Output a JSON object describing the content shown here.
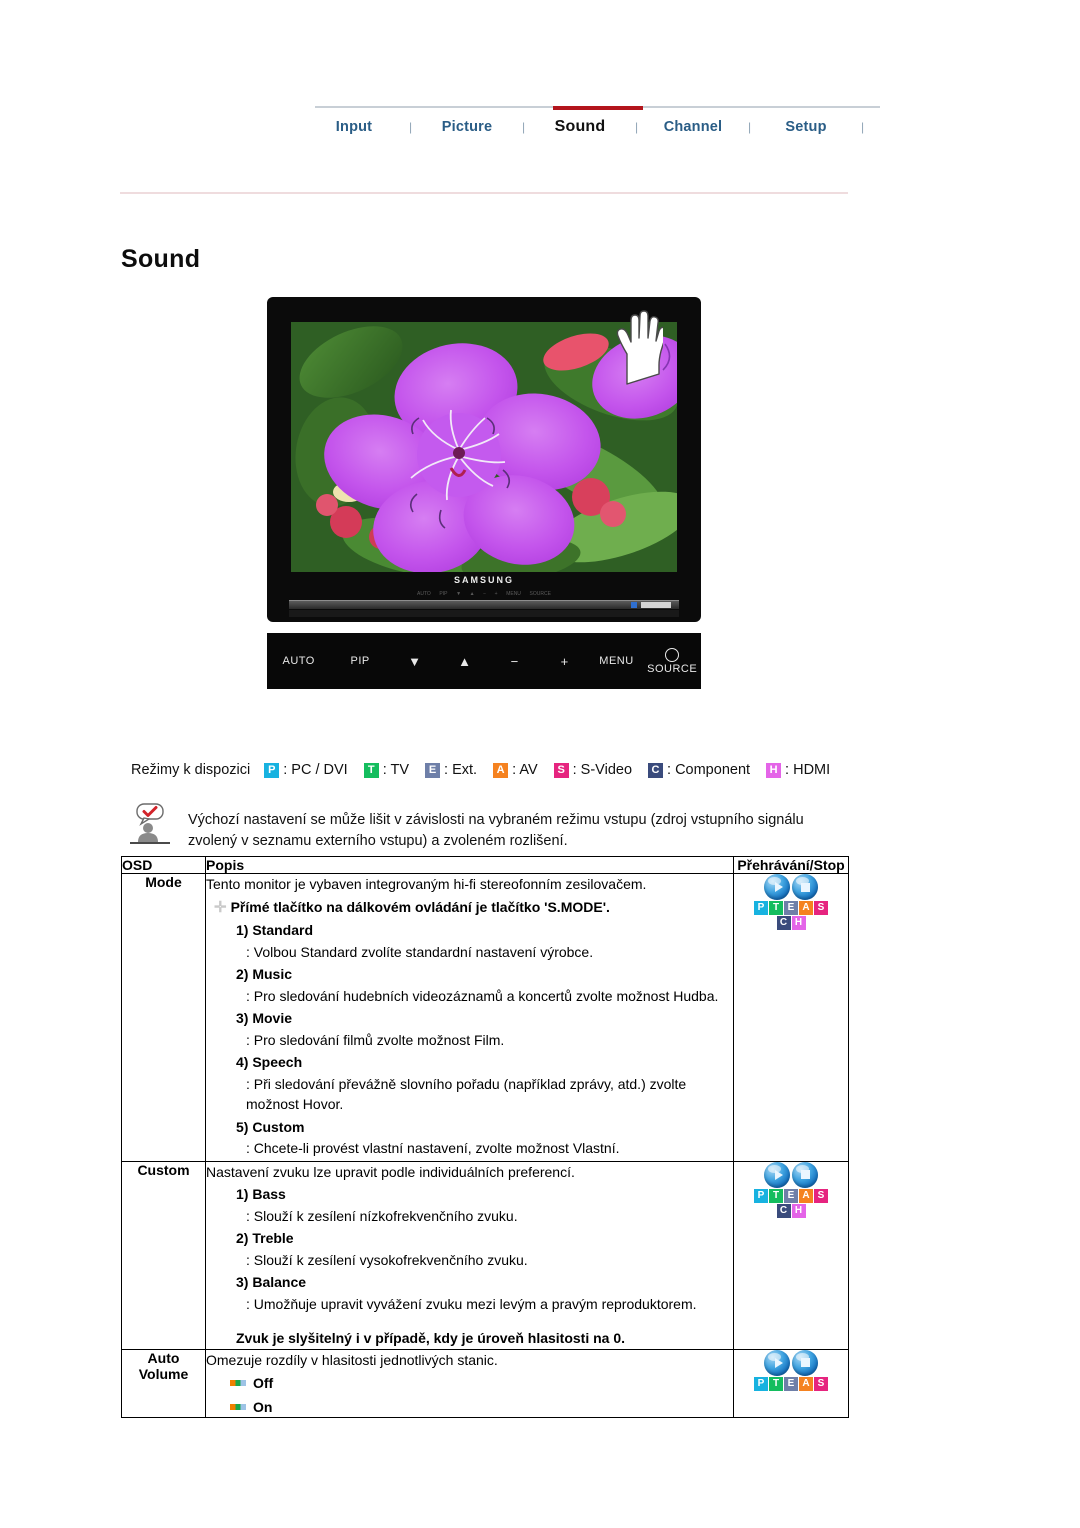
{
  "nav": {
    "items": [
      {
        "label": "Input",
        "active": false
      },
      {
        "label": "Picture",
        "active": false
      },
      {
        "label": "Sound",
        "active": true
      },
      {
        "label": "Channel",
        "active": false
      },
      {
        "label": "Setup",
        "active": false
      }
    ],
    "separator": "|",
    "active_color": "#b3151c"
  },
  "page": {
    "title": "Sound"
  },
  "monitor": {
    "brand": "SAMSUNG",
    "front_buttons": [
      "AUTO",
      "PIP",
      "▼",
      "▲",
      "−",
      "+",
      "MENU",
      "SOURCE"
    ],
    "bezel_buttons": [
      "AUTO",
      "PIP",
      "▼",
      "▲",
      "−",
      "+",
      "MENU",
      "SOURCE"
    ]
  },
  "modes": {
    "label": "Režimy k dispozici",
    "items": [
      {
        "key": "P",
        "color": "#17b2e0",
        "text": ": PC / DVI"
      },
      {
        "key": "T",
        "color": "#14bd5e",
        "text": ": TV"
      },
      {
        "key": "E",
        "color": "#6e7fa8",
        "text": ": Ext."
      },
      {
        "key": "A",
        "color": "#f58220",
        "text": ": AV"
      },
      {
        "key": "S",
        "color": "#e6247f",
        "text": ": S-Video"
      },
      {
        "key": "C",
        "color": "#3a4b7c",
        "text": ": Component"
      },
      {
        "key": "H",
        "color": "#e464e8",
        "text": ": HDMI"
      }
    ]
  },
  "note": {
    "icon": "note-person-icon",
    "text": "Výchozí nastavení se může lišit v závislosti na vybraném režimu vstupu (zdroj vstupního signálu zvolený v seznamu externího vstupu) a zvoleném rozlišení."
  },
  "table": {
    "headers": [
      "OSD",
      "Popis",
      "Přehrávání/Stop"
    ],
    "rows": [
      {
        "osd": "Mode",
        "osd_line2": "",
        "intro": "Tento monitor je vybaven integrovaným hi-fi stereofonním zesilovačem.",
        "plus_note": "Přímé tlačítko na dálkovém ovládání je tlačítko 'S.MODE'.",
        "subitems": [
          {
            "title": "1) Standard",
            "desc": ": Volbou Standard zvolíte standardní nastavení výrobce."
          },
          {
            "title": "2) Music",
            "desc": ": Pro sledování hudebních videozáznamů a koncertů zvolte možnost Hudba."
          },
          {
            "title": "3) Movie",
            "desc": ": Pro sledování filmů zvolte možnost Film."
          },
          {
            "title": "4) Speech",
            "desc": ": Při sledování převážně slovního pořadu (například zprávy, atd.) zvolte možnost Hovor."
          },
          {
            "title": "5) Custom",
            "desc": ": Chcete-li provést vlastní nastavení, zvolte možnost Vlastní."
          }
        ],
        "bold_note": "",
        "options": [],
        "badges_row1": [
          "P",
          "T",
          "E",
          "A",
          "S"
        ],
        "badges_row2": [
          "C",
          "H"
        ]
      },
      {
        "osd": "Custom",
        "osd_line2": "",
        "intro": "Nastavení zvuku lze upravit podle individuálních preferencí.",
        "plus_note": "",
        "subitems": [
          {
            "title": "1) Bass",
            "desc": ": Slouží k zesílení nízkofrekvenčního zvuku."
          },
          {
            "title": "2) Treble",
            "desc": ": Slouží k zesílení vysokofrekvenčního zvuku."
          },
          {
            "title": "3) Balance",
            "desc": ": Umožňuje upravit vyvážení zvuku mezi levým a pravým reproduktorem."
          }
        ],
        "bold_note": "Zvuk je slyšitelný i v případě, kdy je úroveň hlasitosti na 0.",
        "options": [],
        "badges_row1": [
          "P",
          "T",
          "E",
          "A",
          "S"
        ],
        "badges_row2": [
          "C",
          "H"
        ]
      },
      {
        "osd": "Auto",
        "osd_line2": "Volume",
        "intro": "Omezuje rozdíly v hlasitosti jednotlivých stanic.",
        "plus_note": "",
        "subitems": [],
        "bold_note": "",
        "options": [
          "Off",
          "On"
        ],
        "badges_row1": [
          "P",
          "T",
          "E",
          "A",
          "S"
        ],
        "badges_row2": []
      }
    ]
  },
  "badge_colors": {
    "P": "#17b2e0",
    "T": "#14bd5e",
    "E": "#6e7fa8",
    "A": "#f58220",
    "S": "#e6247f",
    "C": "#3a4b7c",
    "H": "#e464e8"
  }
}
